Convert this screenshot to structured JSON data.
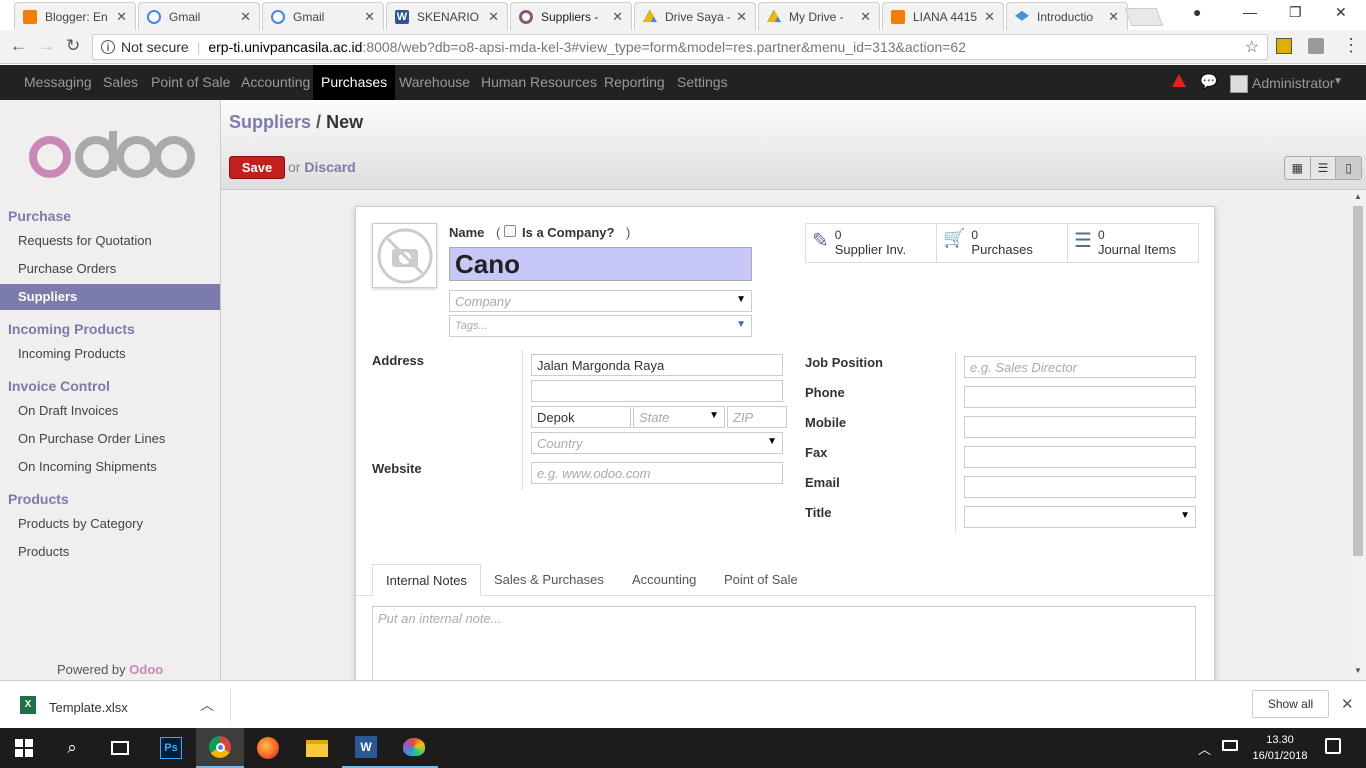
{
  "browser": {
    "tabs": [
      {
        "title": "Blogger: En",
        "color": "#f57d00"
      },
      {
        "title": "Gmail",
        "color": "#4285f4"
      },
      {
        "title": "Gmail",
        "color": "#4285f4"
      },
      {
        "title": "SKENARIO I",
        "color": "#2b5797"
      },
      {
        "title": "Suppliers -",
        "color": "#875a7b"
      },
      {
        "title": "Drive Saya -",
        "color": "#0f9d58"
      },
      {
        "title": "My Drive -",
        "color": "#0f9d58"
      },
      {
        "title": "LIANA 4415",
        "color": "#f57d00"
      },
      {
        "title": "Introductio",
        "color": "#4a90d9"
      }
    ],
    "security": "Not secure",
    "url_host": "erp-ti.univpancasila.ac.id",
    "url_rest": ":8008/web?db=o8-apsi-mda-kel-3#view_type=form&model=res.partner&menu_id=313&action=62"
  },
  "topmenu": {
    "items": [
      "Messaging",
      "Sales",
      "Point of Sale",
      "Accounting",
      "Purchases",
      "Warehouse",
      "Human Resources",
      "Reporting",
      "Settings"
    ],
    "active": "Purchases",
    "user": "Administrator"
  },
  "sidebar": {
    "logo": "odoo",
    "sections": [
      {
        "title": "Purchase",
        "items": [
          "Requests for Quotation",
          "Purchase Orders",
          "Suppliers"
        ]
      },
      {
        "title": "Incoming Products",
        "items": [
          "Incoming Products"
        ]
      },
      {
        "title": "Invoice Control",
        "items": [
          "On Draft Invoices",
          "On Purchase Order Lines",
          "On Incoming Shipments"
        ]
      },
      {
        "title": "Products",
        "items": [
          "Products by Category",
          "Products"
        ]
      }
    ],
    "active_item": "Suppliers",
    "powered_by": "Powered by",
    "powered_brand": "Odoo"
  },
  "header": {
    "breadcrumb_parent": "Suppliers",
    "breadcrumb_sep": "/",
    "breadcrumb_current": "New",
    "save_label": "Save",
    "discard_or": "or",
    "discard_label": "Discard"
  },
  "form": {
    "name_label": "Name",
    "is_company_label": "Is a Company?",
    "name_value": "Cano",
    "company_placeholder": "Company",
    "tags_placeholder": "Tags...",
    "stats": [
      {
        "count": "0",
        "label": "Supplier Inv."
      },
      {
        "count": "0",
        "label": "Purchases"
      },
      {
        "count": "0",
        "label": "Journal Items"
      }
    ],
    "address_label": "Address",
    "street": "Jalan Margonda Raya",
    "street2": "",
    "city": "Depok",
    "state_placeholder": "State",
    "zip_placeholder": "ZIP",
    "country_placeholder": "Country",
    "website_label": "Website",
    "website_placeholder": "e.g. www.odoo.com",
    "job_position_label": "Job Position",
    "job_position_placeholder": "e.g. Sales Director",
    "phone_label": "Phone",
    "mobile_label": "Mobile",
    "fax_label": "Fax",
    "email_label": "Email",
    "title_label": "Title",
    "tabs": [
      "Internal Notes",
      "Sales & Purchases",
      "Accounting",
      "Point of Sale"
    ],
    "notes_placeholder": "Put an internal note..."
  },
  "download": {
    "filename": "Template.xlsx",
    "show_all": "Show all"
  },
  "taskbar": {
    "time": "13.30",
    "date": "16/01/2018"
  }
}
